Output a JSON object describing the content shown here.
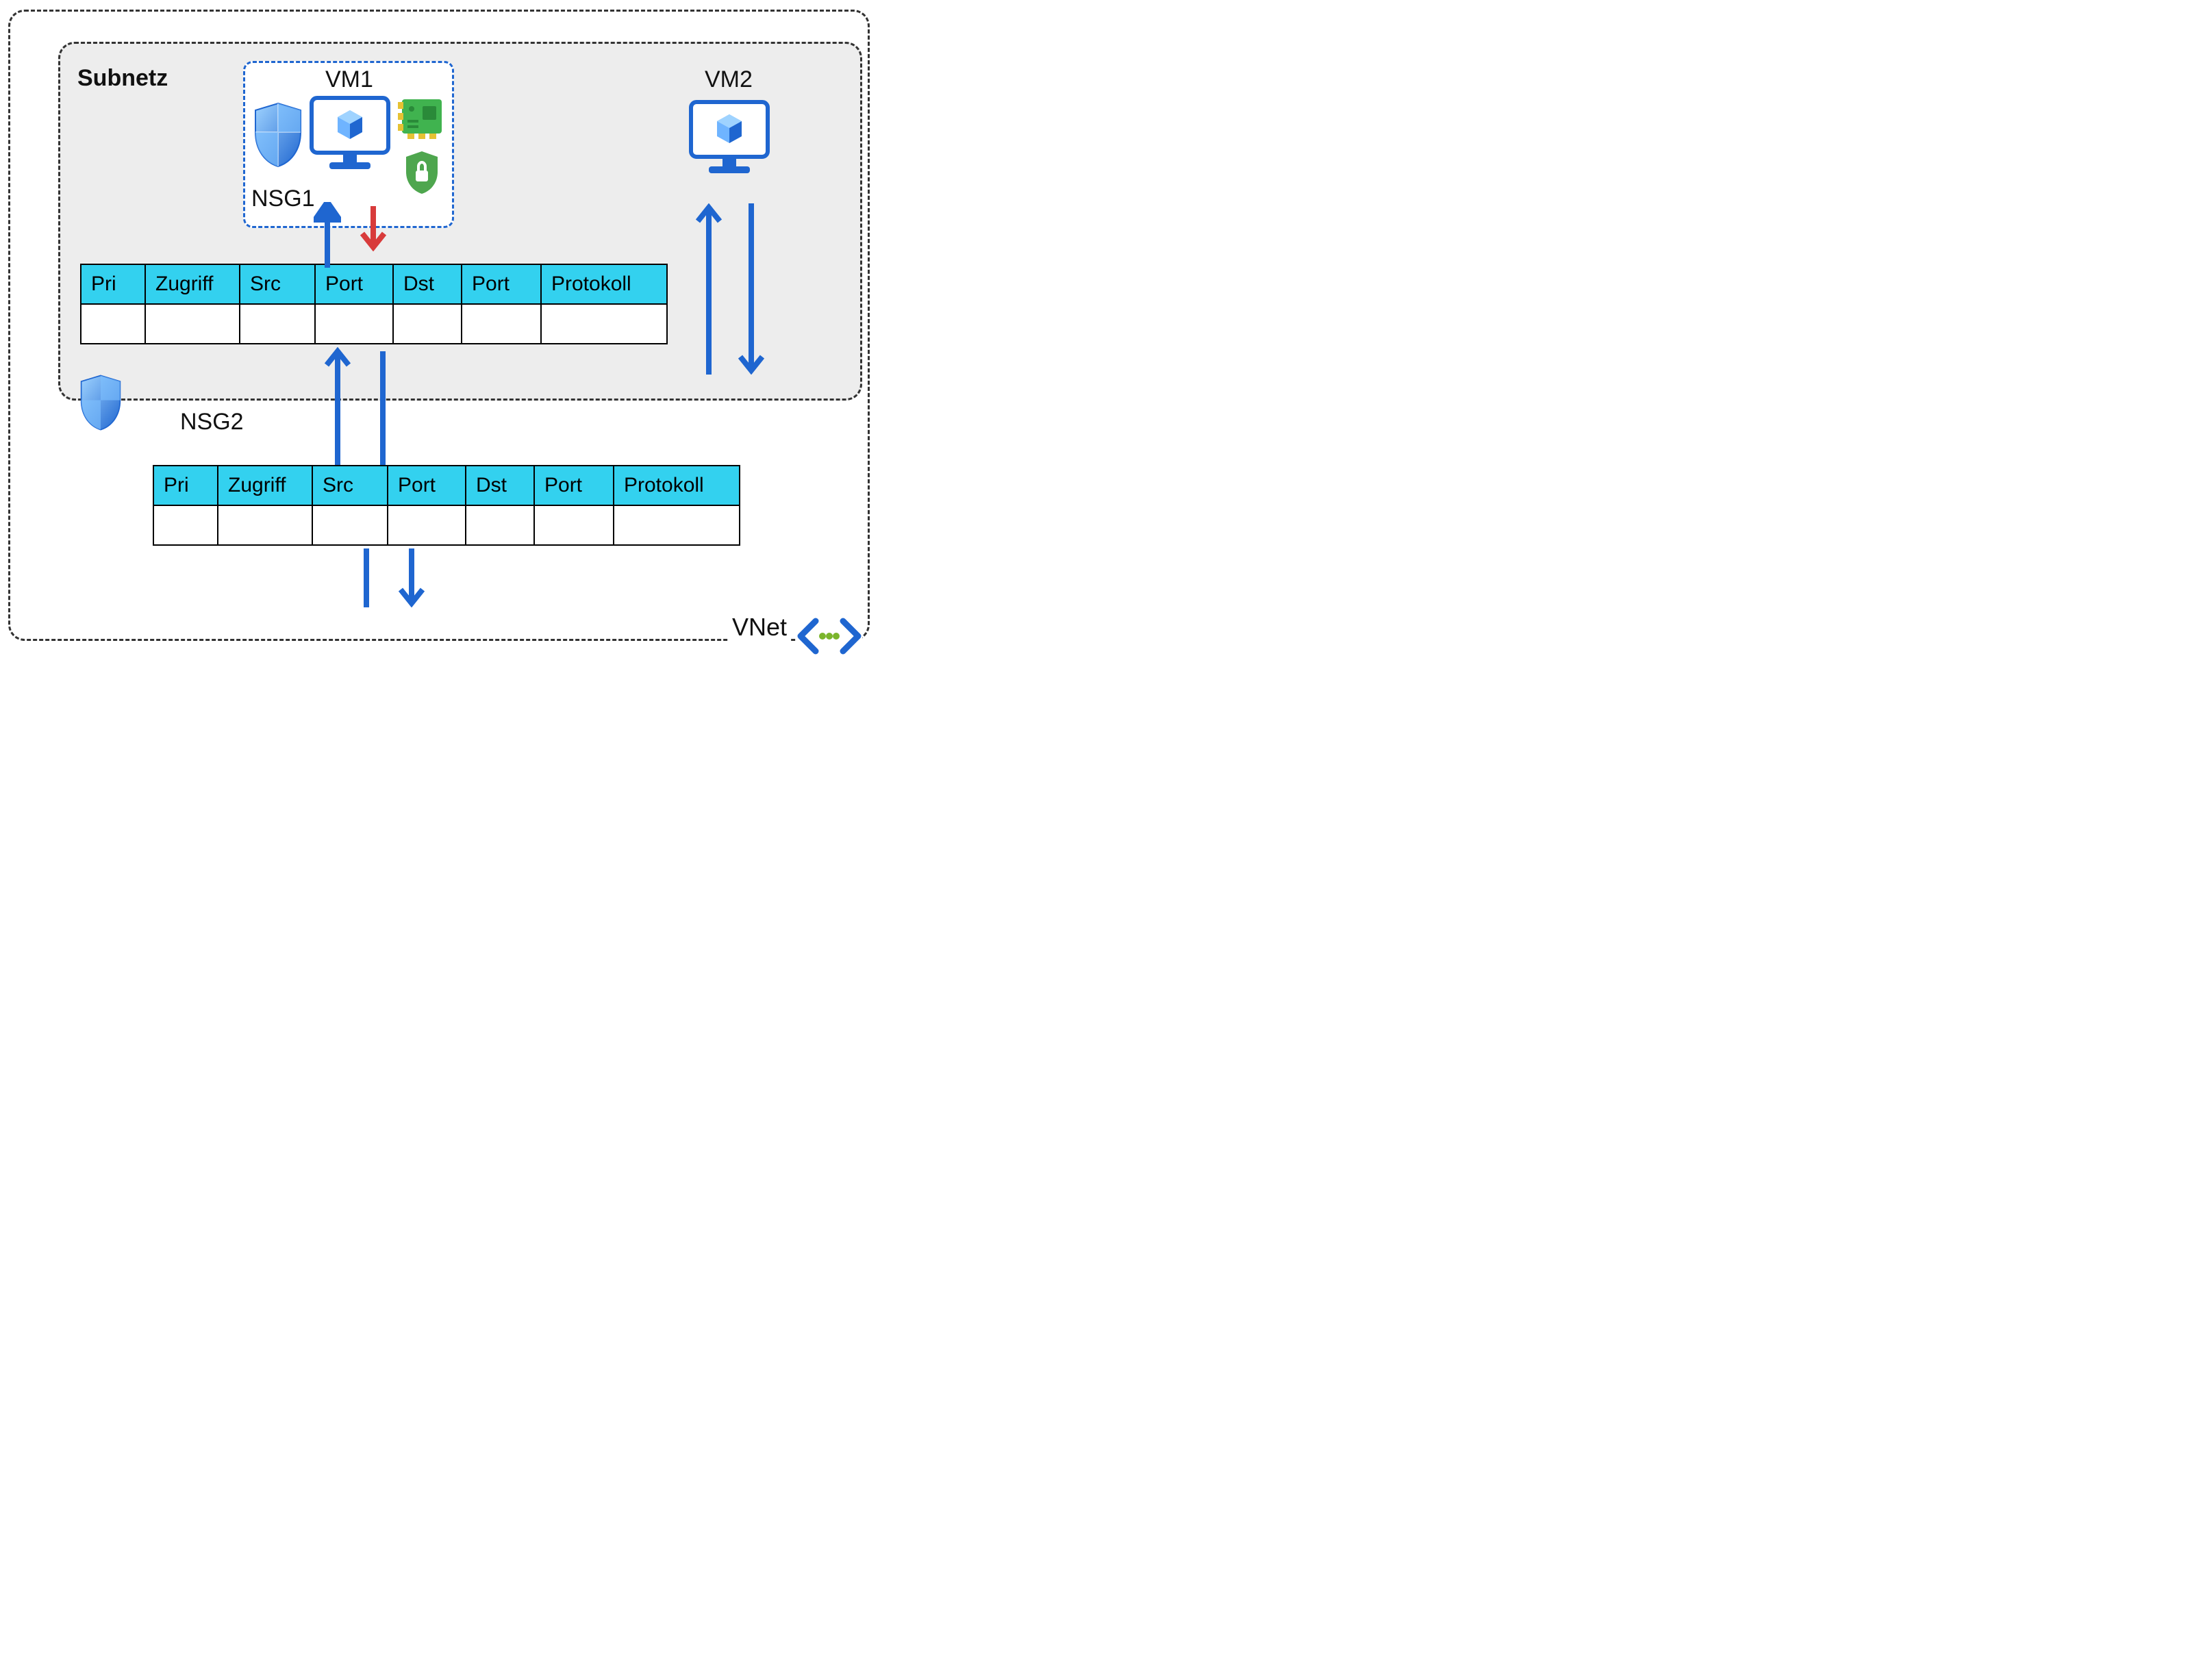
{
  "labels": {
    "subnet": "Subnetz",
    "vm1": "VM1",
    "vm2": "VM2",
    "nsg1": "NSG1",
    "nsg2": "NSG2",
    "vnet": "VNet"
  },
  "nsg_table": {
    "headers": [
      "Pri",
      "Zugriff",
      "Src",
      "Port",
      "Dst",
      "Port",
      "Protokoll"
    ]
  },
  "colors": {
    "dash_border": "#333333",
    "subnet_bg": "#ededed",
    "vm_box_border": "#1f66d0",
    "table_header": "#33d1ef",
    "arrow_blue": "#1f66d0",
    "arrow_red": "#d83b3b",
    "shield_blue_light": "#6fb4ff",
    "shield_blue_dark": "#1f66d0",
    "nic_green": "#40b34f",
    "nic_gold": "#e6c233",
    "lock_green": "#4ea64e",
    "vnet_icon_blue": "#1f66d0",
    "vnet_icon_green": "#7bb52c"
  }
}
